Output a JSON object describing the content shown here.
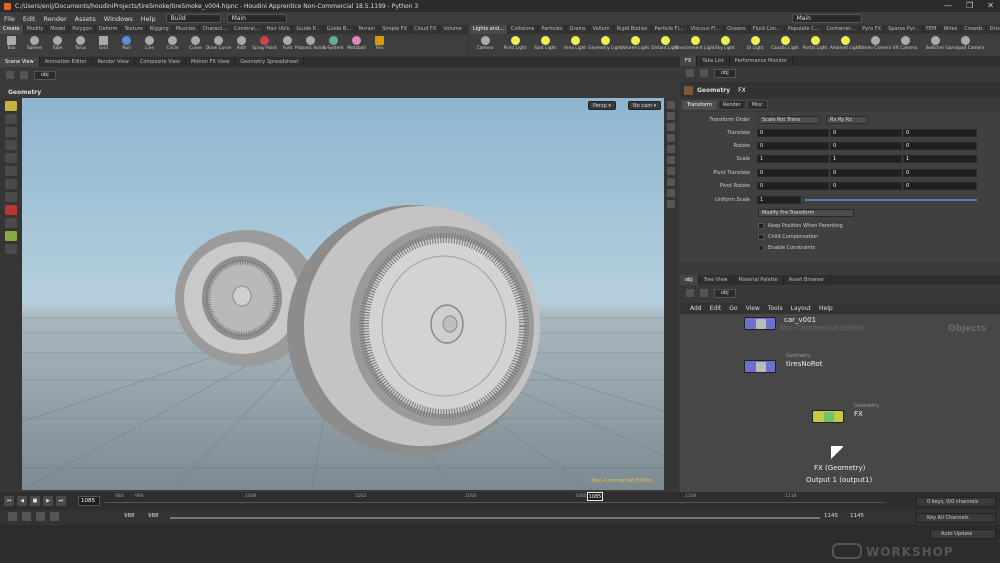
{
  "window": {
    "title": "C:/Users/enij/Documents/houdiniProjects/tireSmoke/tireSmoke_v004.hipnc - Houdini Apprentice Non-Commercial 18.5.1199 - Python 3",
    "controls": [
      "—",
      "❐",
      "✕"
    ]
  },
  "menu": [
    "File",
    "Edit",
    "Render",
    "Assets",
    "Windows",
    "Help"
  ],
  "desktop_build": "Build",
  "desktop_main": "Main",
  "desktop_right": "Main",
  "shelf_tabs_left": [
    "Create",
    "Modify",
    "Model",
    "Polygon",
    "Deform",
    "Texture",
    "Rigging",
    "Muscles",
    "Charact...",
    "Constrai...",
    "Hair Utils",
    "Guide P...",
    "Guide B...",
    "Terrain",
    "Simple FX",
    "Cloud FX",
    "Volume"
  ],
  "shelf_tools_left": [
    "Box",
    "Sphere",
    "Tube",
    "Torus",
    "Grid",
    "Null",
    "Line",
    "Circle",
    "Curve",
    "Draw Curve",
    "Path",
    "Spray Paint",
    "Font",
    "Platonic Solids",
    "L-System",
    "Metaball",
    "File"
  ],
  "shelf_tabs_right": [
    "Lights and...",
    "Collisions",
    "Particles",
    "Grains",
    "Vellum",
    "Rigid Bodies",
    "Particle Fl...",
    "Viscous Fl...",
    "Oceans",
    "Fluid Con...",
    "Populate C...",
    "Container...",
    "Pyro FX",
    "Sparse Pyr...",
    "FEM",
    "Wires",
    "Crowds",
    "Drive Sim"
  ],
  "shelf_tools_right": [
    "Camera",
    "Point Light",
    "Spot Light",
    "Area Light",
    "Geometry Light",
    "Volume Light",
    "Distant Light",
    "Environment Light",
    "Sky Light",
    "GI Light",
    "Caustic Light",
    "Portal Light",
    "Ambient Light",
    "Stereo Camera",
    "VR Camera",
    "Switcher",
    "Gamepad Camera"
  ],
  "pane_tabs_left": [
    "Scene View",
    "Animation Editor",
    "Render View",
    "Composite View",
    "Motion FX View",
    "Geometry Spreadsheet"
  ],
  "viewport": {
    "path": "obj",
    "header": "Geometry",
    "persp": "Persp",
    "cam": "No cam",
    "watermark": "Non-Commercial Edition"
  },
  "timeline": {
    "frame": "1085",
    "current": "1085",
    "ticks": [
      "980",
      "984",
      "1008",
      "1032",
      "1056",
      "1080",
      "1104",
      "1118"
    ],
    "start1": "988",
    "start2": "988",
    "end1": "1145",
    "end2": "1145",
    "keys_info": "0 keys, 0/0 channels",
    "key_all": "Key All Channels",
    "auto_update": "Auto Update"
  },
  "right_tabs": [
    "FX",
    "Take List",
    "Performance Monitor"
  ],
  "right_path": "obj",
  "params": {
    "node_type": "Geometry",
    "node_name": "FX",
    "tabs": [
      "Transform",
      "Render",
      "Misc"
    ],
    "transform_order_label": "Transform Order",
    "transform_order": "Scale Rot Trans",
    "rot_order": "Rx Ry Rz",
    "rows": [
      {
        "label": "Translate",
        "v": [
          "0",
          "0",
          "0"
        ]
      },
      {
        "label": "Rotate",
        "v": [
          "0",
          "0",
          "0"
        ]
      },
      {
        "label": "Scale",
        "v": [
          "1",
          "1",
          "1"
        ]
      },
      {
        "label": "Pivot Translate",
        "v": [
          "0",
          "0",
          "0"
        ]
      },
      {
        "label": "Pivot Rotate",
        "v": [
          "0",
          "0",
          "0"
        ]
      }
    ],
    "uniform_scale_label": "Uniform Scale",
    "uniform_scale": "1",
    "modify_pre": "Modify Pre-Transform",
    "checks": [
      "Keep Position When Parenting",
      "Child Compensation",
      "Enable Constraints"
    ]
  },
  "net_tabs": [
    "obj",
    "Tree View",
    "Material Palette",
    "Asset Browser"
  ],
  "net_path": "obj",
  "net_menu": [
    "Add",
    "Edit",
    "Go",
    "View",
    "Tools",
    "Layout",
    "Help"
  ],
  "network": {
    "watermark_obj": "Objects",
    "watermark_nc": "Non-Commercial Edition",
    "nodes": [
      {
        "name": "car_v001",
        "type": ""
      },
      {
        "name": "tiresNoRot",
        "type": "Geometry"
      },
      {
        "name": "FX",
        "type": "Geometry"
      }
    ],
    "tooltip_title": "FX (Geometry)",
    "tooltip_sub": "Output 1 (output1)"
  },
  "logo": "WORKSHOP"
}
